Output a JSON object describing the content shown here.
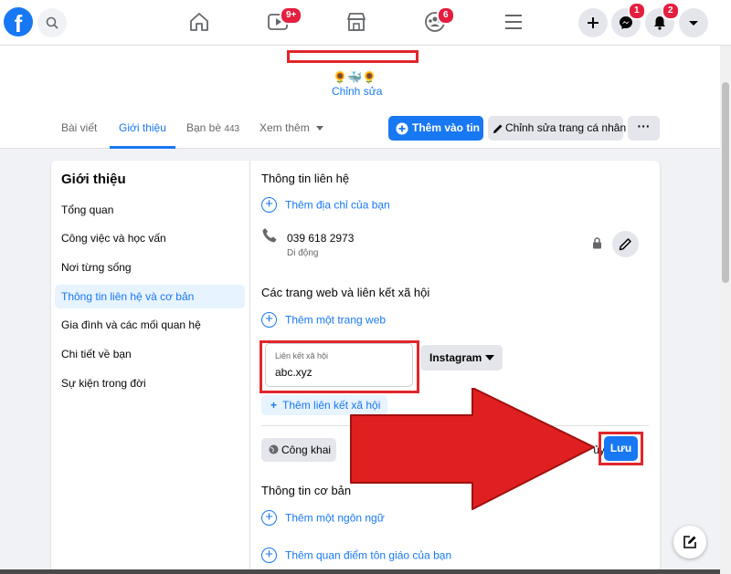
{
  "topbar": {
    "logo": "f",
    "badges": {
      "watch": "9+",
      "groups": "6",
      "messenger": "1",
      "notifications": "2"
    },
    "icons": [
      "search-icon",
      "home-icon",
      "watch-icon",
      "marketplace-icon",
      "groups-icon",
      "menu-icon",
      "plus-icon",
      "messenger-icon",
      "bell-icon",
      "caret-down-icon"
    ]
  },
  "profile": {
    "emojis": "🌻🐳🌻",
    "edit_label": "Chỉnh sửa",
    "tabs": [
      {
        "label": "Bài viết"
      },
      {
        "label": "Giới thiệu"
      },
      {
        "label": "Bạn bè",
        "count": "443"
      },
      {
        "label": "Xem thêm"
      }
    ],
    "add_story_label": "Thêm vào tin",
    "edit_profile_label": "Chỉnh sửa trang cá nhân",
    "more_label": "···"
  },
  "sidebar": {
    "title": "Giới thiệu",
    "items": [
      {
        "label": "Tổng quan"
      },
      {
        "label": "Công việc và học vấn"
      },
      {
        "label": "Nơi từng sống"
      },
      {
        "label": "Thông tin liên hệ và cơ bản"
      },
      {
        "label": "Gia đình và các mối quan hệ"
      },
      {
        "label": "Chi tiết về bạn"
      },
      {
        "label": "Sự kiện trong đời"
      }
    ]
  },
  "contact": {
    "title": "Thông tin liên hệ",
    "add_address": "Thêm địa chỉ của bạn",
    "phone": "039 618 2973",
    "phone_type": "Di động"
  },
  "websites": {
    "title": "Các trang web và liên kết xã hội",
    "add_website": "Thêm một trang web",
    "social_field_label": "Liên kết xã hội",
    "social_field_value": "abc.xyz",
    "social_platform": "Instagram",
    "add_social": "Thêm liên kết xã hội",
    "privacy": "Công khai",
    "cancel_label": "ủy",
    "save_label": "Lưu"
  },
  "basic": {
    "title": "Thông tin cơ bản",
    "add_language": "Thêm một ngôn ngữ",
    "add_religion": "Thêm quan điểm tôn giáo của bạn"
  },
  "colors": {
    "brand": "#1877f2",
    "highlight": "#e0262b",
    "arrow": "#e02020"
  }
}
